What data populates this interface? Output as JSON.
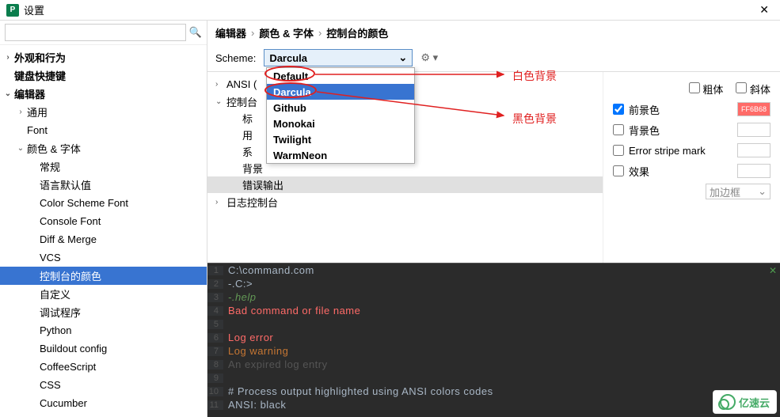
{
  "titlebar": {
    "title": "设置"
  },
  "search": {
    "placeholder": ""
  },
  "sidebar": {
    "items": [
      {
        "label": "外观和行为",
        "level": 1,
        "arrow": "›"
      },
      {
        "label": "键盘快捷键",
        "level": 1,
        "arrow": ""
      },
      {
        "label": "编辑器",
        "level": 1,
        "arrow": "⌄"
      },
      {
        "label": "通用",
        "level": 2,
        "arrow": "›"
      },
      {
        "label": "Font",
        "level": 2,
        "arrow": ""
      },
      {
        "label": "颜色 & 字体",
        "level": 2,
        "arrow": "⌄"
      },
      {
        "label": "常规",
        "level": 3,
        "arrow": ""
      },
      {
        "label": "语言默认值",
        "level": 3,
        "arrow": ""
      },
      {
        "label": "Color Scheme Font",
        "level": 3,
        "arrow": ""
      },
      {
        "label": "Console Font",
        "level": 3,
        "arrow": ""
      },
      {
        "label": "Diff & Merge",
        "level": 3,
        "arrow": ""
      },
      {
        "label": "VCS",
        "level": 3,
        "arrow": ""
      },
      {
        "label": "控制台的颜色",
        "level": 3,
        "arrow": "",
        "selected": true
      },
      {
        "label": "自定义",
        "level": 3,
        "arrow": ""
      },
      {
        "label": "调试程序",
        "level": 3,
        "arrow": ""
      },
      {
        "label": "Python",
        "level": 3,
        "arrow": ""
      },
      {
        "label": "Buildout config",
        "level": 3,
        "arrow": ""
      },
      {
        "label": "CoffeeScript",
        "level": 3,
        "arrow": ""
      },
      {
        "label": "CSS",
        "level": 3,
        "arrow": ""
      },
      {
        "label": "Cucumber",
        "level": 3,
        "arrow": ""
      }
    ]
  },
  "breadcrumb": {
    "parts": [
      "编辑器",
      "颜色 & 字体",
      "控制台的颜色"
    ]
  },
  "scheme": {
    "label": "Scheme:",
    "value": "Darcula",
    "options": [
      "Default",
      "Darcula",
      "Github",
      "Monokai",
      "Twilight",
      "WarmNeon"
    ],
    "highlighted": "Darcula"
  },
  "categories": {
    "items": [
      {
        "label": "ANSI (",
        "arrow": "›"
      },
      {
        "label": "控制台",
        "arrow": "⌄",
        "children": [
          "标",
          "用",
          "系",
          "背景",
          "错误输出"
        ],
        "selected_child": "错误输出"
      },
      {
        "label": "日志控制台",
        "arrow": "›"
      }
    ]
  },
  "props": {
    "rows": [
      {
        "key": "bold",
        "label": "粗体",
        "checked": false
      },
      {
        "key": "italic",
        "label": "斜体",
        "checked": false
      },
      {
        "key": "fg",
        "label": "前景色",
        "checked": true,
        "color": "FF6B68"
      },
      {
        "key": "bg",
        "label": "背景色",
        "checked": false
      },
      {
        "key": "stripe",
        "label": "Error stripe mark",
        "checked": false
      },
      {
        "key": "effect",
        "label": "效果",
        "checked": false
      }
    ],
    "border_select": "加边框"
  },
  "console": {
    "lines": [
      {
        "n": "1",
        "txt": "C:\\command.com",
        "cls": ""
      },
      {
        "n": "2",
        "txt": "-.C:>",
        "cls": ""
      },
      {
        "n": "3",
        "txt": "-.help",
        "cls": "c-green"
      },
      {
        "n": "4",
        "txt": "Bad command or file name",
        "cls": "c-red"
      },
      {
        "n": "5",
        "txt": "",
        "cls": ""
      },
      {
        "n": "6",
        "txt": "Log error",
        "cls": "c-red"
      },
      {
        "n": "7",
        "txt": "Log warning",
        "cls": "c-orange"
      },
      {
        "n": "8",
        "txt": "An expired log entry",
        "cls": "c-gray"
      },
      {
        "n": "9",
        "txt": "",
        "cls": ""
      },
      {
        "n": "10",
        "txt": "# Process output highlighted using ANSI colors codes",
        "cls": "c-bold"
      },
      {
        "n": "11",
        "txt": "ANSI: black",
        "cls": ""
      }
    ]
  },
  "annotations": {
    "white_bg": "白色背景",
    "black_bg": "黑色背景"
  },
  "watermark": {
    "text": "亿速云"
  }
}
